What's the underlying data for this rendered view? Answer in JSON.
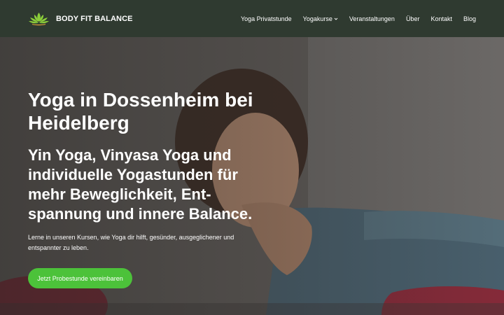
{
  "brand": {
    "name": "BODY FIT BALANCE",
    "logo_icon": "lotus-icon",
    "logo_color": "#8ccf3a"
  },
  "nav": {
    "items": [
      {
        "label": "Yoga Privatstunde",
        "dropdown": false
      },
      {
        "label": "Yogakurse",
        "dropdown": true
      },
      {
        "label": "Veranstaltungen",
        "dropdown": false
      },
      {
        "label": "Über",
        "dropdown": false
      },
      {
        "label": "Kontakt",
        "dropdown": false
      },
      {
        "label": "Blog",
        "dropdown": false
      }
    ]
  },
  "hero": {
    "title": "Yoga in Dossenheim bei Heidelberg",
    "subtitle": "Yin Yoga, Vinyasa Yoga und individuelle Yogastunden für mehr Beweglichkeit, Ent-spannung und innere Balance.",
    "text": "Lerne in unseren Kursen, wie Yoga dir hilft, gesünder, ausgeglichener und entspannter zu leben.",
    "cta_label": "Jetzt Probestunde vereinbaren"
  },
  "colors": {
    "header_bg": "#2f3a30",
    "cta_bg": "#4cc23a",
    "text": "#ffffff"
  }
}
